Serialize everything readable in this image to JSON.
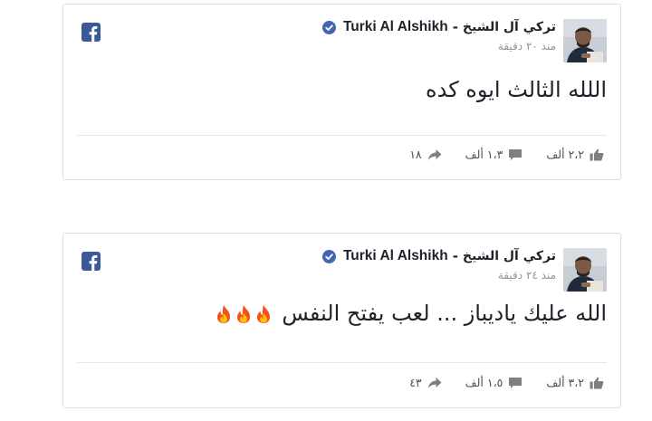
{
  "posts": [
    {
      "author_latin": "Turki Al Alshikh",
      "author_separator": "-",
      "author_arabic": "تركي آل الشيخ",
      "time": "منذ ٢٠ دقيقة",
      "text": "اللله الثالث ايوه كده",
      "fire_count": 0,
      "likes": "٢،٢ ألف",
      "comments": "١،٣ ألف",
      "shares": "١٨",
      "icons": [
        "facebook-icon",
        "verified-icon",
        "like-icon",
        "comment-icon",
        "share-icon"
      ]
    },
    {
      "author_latin": "Turki Al Alshikh",
      "author_separator": "-",
      "author_arabic": "تركي آل الشيخ",
      "time": "منذ ٢٤ دقيقة",
      "text": "الله عليك ياديباز ... لعب يفتح النفس",
      "fire_count": 3,
      "likes": "٣،٢ ألف",
      "comments": "١،٥ ألف",
      "shares": "٤٣",
      "icons": [
        "facebook-icon",
        "verified-icon",
        "like-icon",
        "comment-icon",
        "share-icon",
        "fire-icon"
      ]
    }
  ],
  "colors": {
    "facebook_blue": "#3b5998",
    "verified_blue": "#4267b2",
    "text_dark": "#1d2129",
    "text_muted": "#90949c",
    "border": "#dddfe2",
    "stat_text": "#4b4f56"
  }
}
